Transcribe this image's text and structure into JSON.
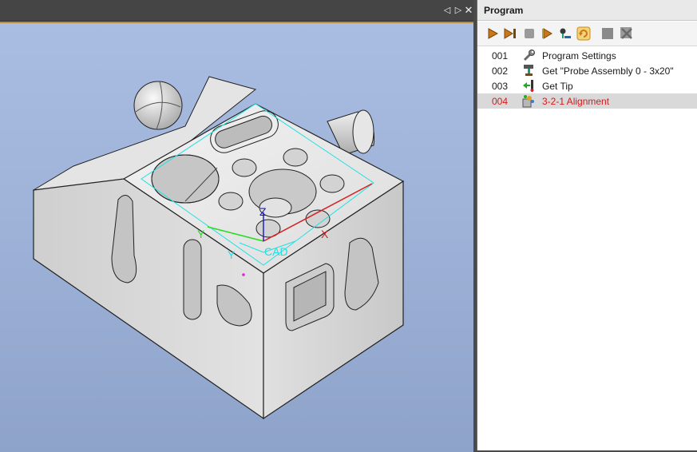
{
  "viewport": {
    "controls": {
      "pin": "◁",
      "next": "▷",
      "close": "✕"
    },
    "axis_labels": {
      "x": "X",
      "y": "Y",
      "z": "Z",
      "y2": "Y",
      "cad": "CAD"
    }
  },
  "program": {
    "title": "Program",
    "toolbar": [
      "play-icon",
      "step-icon",
      "stop-icon",
      "run-from-icon",
      "probe-icon",
      "refresh-icon",
      "gray-square-icon",
      "gray-clear-icon"
    ],
    "items": [
      {
        "num": "001",
        "label": "Program Settings",
        "icon": "wrench-icon"
      },
      {
        "num": "002",
        "label": "Get \"Probe Assembly 0 - 3x20\"",
        "icon": "probe-assembly-icon"
      },
      {
        "num": "003",
        "label": "Get Tip",
        "icon": "get-tip-icon"
      },
      {
        "num": "004",
        "label": "3-2-1 Alignment",
        "icon": "alignment-icon",
        "selected": true
      }
    ]
  },
  "colors": {
    "selected_text": "#d51a1a",
    "selected_bg": "#d9d9d9",
    "axis_x": "#d42020",
    "axis_y": "#22dd22",
    "axis_z": "#2020c0",
    "cad": "#22e0e0"
  }
}
